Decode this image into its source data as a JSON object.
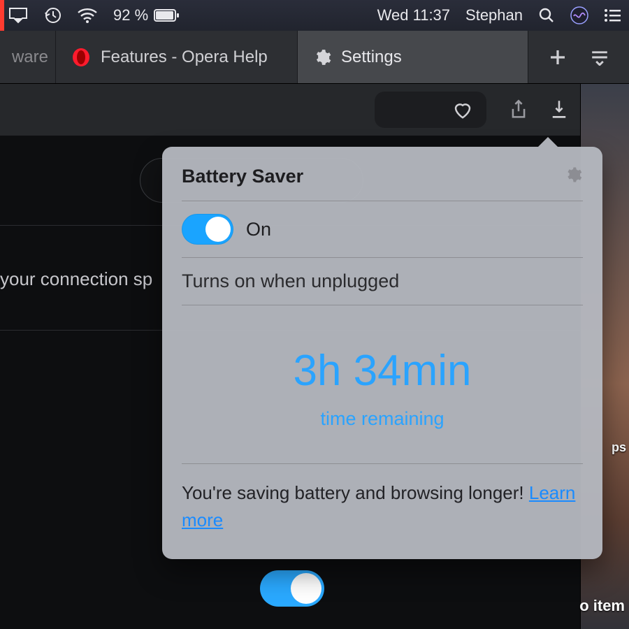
{
  "menubar": {
    "battery_pct": "92 %",
    "clock": "Wed 11:37",
    "user": "Stephan"
  },
  "tabs": {
    "prev_fragment": "ware",
    "help_label": "Features - Opera Help",
    "settings_label": "Settings"
  },
  "settings_page": {
    "connection_fragment": "your connection sp"
  },
  "desktop": {
    "ps_fragment": "ps",
    "item_label": "o item"
  },
  "popover": {
    "title": "Battery Saver",
    "toggle_state": "On",
    "subtext": "Turns on when unplugged",
    "time_big": "3h 34min",
    "time_caption": "time remaining",
    "save_line_prefix": "You're saving battery and browsing longer! ",
    "learn_more": "Learn more"
  }
}
